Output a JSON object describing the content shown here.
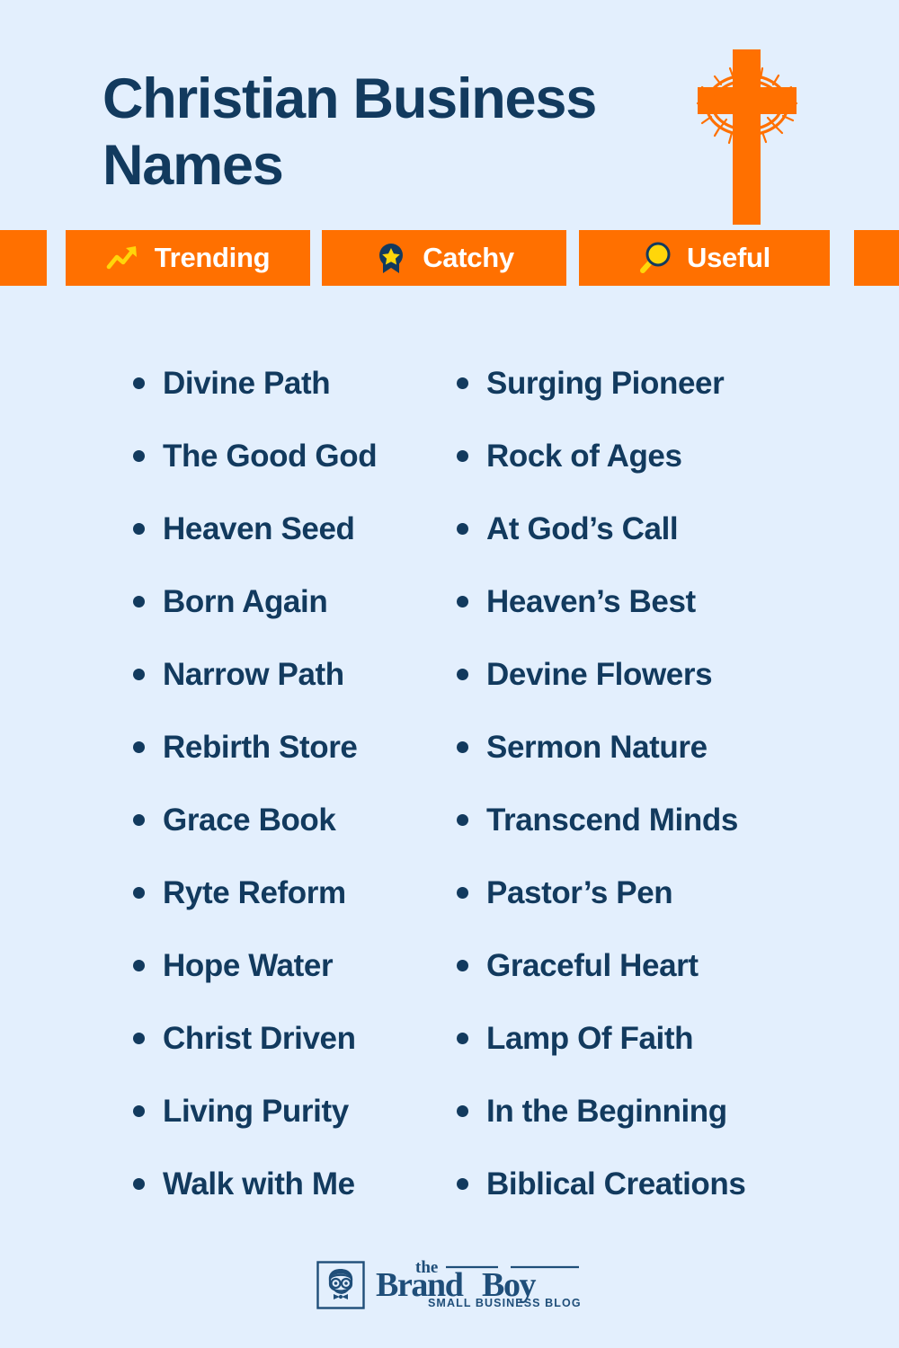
{
  "page": {
    "background_color": "#e3effd",
    "text_color": "#123a5e",
    "accent_color": "#ff7000",
    "badge_text_color": "#ffffff",
    "icon_yellow": "#ffd60a"
  },
  "header": {
    "title_line_1": "Christian Business",
    "title_line_2": "Names",
    "graphic": "cross-with-crown-of-thorns"
  },
  "badges": [
    {
      "label": "Trending",
      "icon": "trending-up-icon"
    },
    {
      "label": "Catchy",
      "icon": "award-ribbon-star-icon"
    },
    {
      "label": "Useful",
      "icon": "magnifying-glass-icon"
    }
  ],
  "lists": {
    "column_1": [
      "Divine Path",
      "The Good God",
      "Heaven Seed",
      "Born Again",
      "Narrow Path",
      "Rebirth Store",
      "Grace Book",
      "Ryte Reform",
      "Hope Water",
      "Christ Driven",
      "Living Purity",
      "Walk with Me"
    ],
    "column_2": [
      "Surging Pioneer",
      "Rock of Ages",
      "At God’s Call",
      "Heaven’s Best",
      "Devine Flowers",
      "Sermon Nature",
      "Transcend Minds",
      "Pastor’s Pen",
      "Graceful Heart",
      "Lamp Of Faith",
      "In the Beginning",
      "Biblical Creations"
    ]
  },
  "footer": {
    "logo_the": "the",
    "logo_brand": "Brand",
    "logo_boy": "Boy",
    "logo_tagline": "SMALL BUSINESS BLOG",
    "logo_mark": "brandboy-mascot-icon"
  }
}
